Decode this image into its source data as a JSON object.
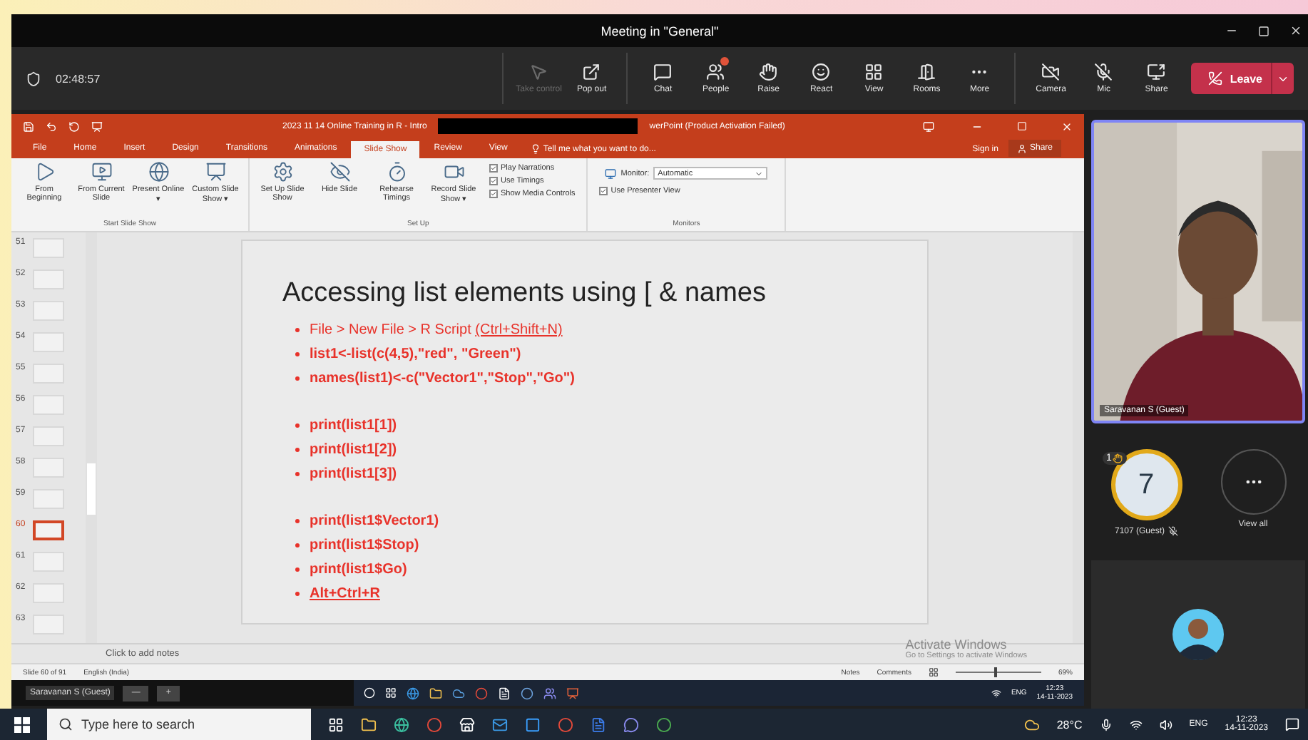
{
  "window": {
    "title": "Meeting in \"General\""
  },
  "toolbar": {
    "timer": "02:48:57",
    "button_groups": [
      [
        {
          "kind": "control",
          "label": "Take control",
          "disabled": true
        },
        {
          "kind": "popout",
          "label": "Pop out",
          "disabled": false
        }
      ],
      [
        {
          "kind": "chat",
          "label": "Chat",
          "disabled": false
        },
        {
          "kind": "people",
          "label": "People",
          "disabled": false,
          "alert": true
        },
        {
          "kind": "raise",
          "label": "Raise",
          "disabled": false
        },
        {
          "kind": "react",
          "label": "React",
          "disabled": false
        },
        {
          "kind": "view",
          "label": "View",
          "disabled": false
        },
        {
          "kind": "rooms",
          "label": "Rooms",
          "disabled": false
        },
        {
          "kind": "more",
          "label": "More",
          "disabled": false
        }
      ],
      [
        {
          "kind": "camera",
          "label": "Camera",
          "disabled": false
        },
        {
          "kind": "mic",
          "label": "Mic",
          "disabled": false
        },
        {
          "kind": "share",
          "label": "Share",
          "disabled": false
        }
      ]
    ],
    "leave": "Leave"
  },
  "presentation": {
    "title_left": "2023 11 14 Online Training in R - Intro",
    "title_right": "werPoint (Product Activation Failed)",
    "tabs": [
      {
        "label": "File",
        "selected": false
      },
      {
        "label": "Home",
        "selected": false
      },
      {
        "label": "Insert",
        "selected": false
      },
      {
        "label": "Design",
        "selected": false
      },
      {
        "label": "Transitions",
        "selected": false
      },
      {
        "label": "Animations",
        "selected": false
      },
      {
        "label": "Slide Show",
        "selected": true
      },
      {
        "label": "Review",
        "selected": false
      },
      {
        "label": "View",
        "selected": false
      }
    ],
    "tell_me": "Tell me what you want to do...",
    "sign_in": "Sign in",
    "share": "Share",
    "ribbon_groups": [
      {
        "label": "Start Slide Show",
        "items": [
          {
            "kind": "begin",
            "label": "From Beginning"
          },
          {
            "kind": "current",
            "label": "From Current Slide"
          },
          {
            "kind": "online",
            "label": "Present Online ▾"
          },
          {
            "kind": "custom",
            "label": "Custom Slide Show ▾"
          }
        ]
      },
      {
        "label": "Set Up",
        "items": [
          {
            "kind": "setup",
            "label": "Set Up Slide Show"
          },
          {
            "kind": "hide",
            "label": "Hide Slide"
          },
          {
            "kind": "rehearse",
            "label": "Rehearse Timings"
          },
          {
            "kind": "record",
            "label": "Record Slide Show ▾"
          }
        ],
        "checks": [
          {
            "label": "Play Narrations",
            "checked": true
          },
          {
            "label": "Use Timings",
            "checked": true
          },
          {
            "label": "Show Media Controls",
            "checked": true
          }
        ]
      },
      {
        "label": "Monitors",
        "monitor_label": "Monitor:",
        "monitor_value": "Automatic",
        "checks": [
          {
            "label": "Use Presenter View",
            "checked": true
          }
        ]
      }
    ],
    "thumbnails": [
      {
        "number": "51",
        "selected": false
      },
      {
        "number": "52",
        "selected": false
      },
      {
        "number": "53",
        "selected": false
      },
      {
        "number": "54",
        "selected": false
      },
      {
        "number": "55",
        "selected": false
      },
      {
        "number": "56",
        "selected": false
      },
      {
        "number": "57",
        "selected": false
      },
      {
        "number": "58",
        "selected": false
      },
      {
        "number": "59",
        "selected": false
      },
      {
        "number": "60",
        "selected": true
      },
      {
        "number": "61",
        "selected": false
      },
      {
        "number": "62",
        "selected": false
      },
      {
        "number": "63",
        "selected": false
      }
    ],
    "slide": {
      "title": "Accessing list elements using [ &  names",
      "groups": [
        [
          {
            "text": "File > New File > R Script ",
            "link": "(Ctrl+Shift+N)",
            "bold": false
          },
          {
            "text": "list1<-list(c(4,5),\"red\", \"Green\")",
            "bold": true
          },
          {
            "text": "names(list1)<-c(\"Vector1\",\"Stop\",\"Go\")",
            "bold": true
          }
        ],
        [
          {
            "text": "print(list1[1])",
            "bold": true
          },
          {
            "text": "print(list1[2])",
            "bold": true
          },
          {
            "text": "print(list1[3])",
            "bold": true
          }
        ],
        [
          {
            "text": "print(list1$Vector1)",
            "bold": true
          },
          {
            "text": "print(list1$Stop)",
            "bold": true
          },
          {
            "text": "print(list1$Go)",
            "bold": true
          },
          {
            "link": "Alt+Ctrl+R",
            "bold": true
          }
        ]
      ]
    },
    "notes_placeholder": "Click to add notes",
    "activation": {
      "title": "Activate Windows",
      "hint": "Go to Settings to activate Windows"
    },
    "status": {
      "slide": "Slide 60 of 91",
      "language": "English (India)",
      "notes": "Notes",
      "comments": "Comments",
      "zoom": "69%",
      "level": 0.45
    },
    "presenter_taskbar": {
      "name": "Saravanan S (Guest)",
      "minus": "—",
      "plus": "+",
      "lang": "ENG",
      "time": "12:23",
      "date": "14-11-2023"
    }
  },
  "participants": {
    "video_name": "Saravanan S (Guest)",
    "attendee": {
      "initial": "7",
      "hand_count": "1",
      "name": "7107 (Guest)",
      "muted": true
    },
    "view_all": "View all"
  },
  "taskbar": {
    "search_placeholder": "Type here to search",
    "weather": "28°C",
    "lang": "ENG",
    "time": "12:23",
    "date": "14-11-2023"
  }
}
